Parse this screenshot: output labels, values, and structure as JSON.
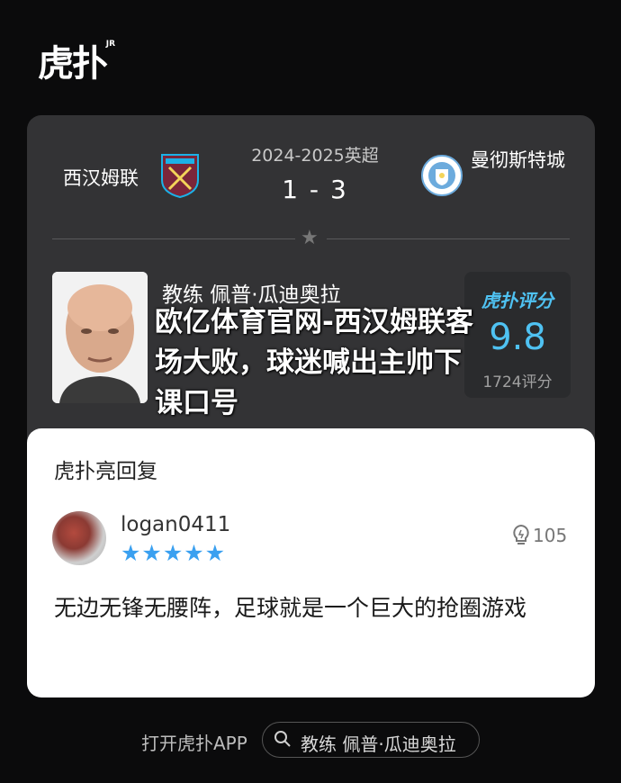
{
  "brand": {
    "logo_text": "虎扑",
    "logo_sup": "JR"
  },
  "match": {
    "home_team": "西汉姆联",
    "away_team": "曼彻斯特城",
    "season": "2024-2025英超",
    "score": "1 - 3"
  },
  "coach": {
    "label": "教练 佩普·瓜迪奥拉"
  },
  "rating": {
    "brand": "虎扑评分",
    "value": "9.8",
    "count": "1724评分"
  },
  "overlay_title": "欧亿体育官网-西汉姆联客场大败，球迷喊出主帅下课口号",
  "reply": {
    "header": "虎扑亮回复",
    "username": "logan0411",
    "stars": "★★★★★",
    "likes": "105",
    "comment": "无边无锋无腰阵，足球就是一个巨大的抢圈游戏"
  },
  "bottom": {
    "open_app": "打开虎扑APP",
    "search_text": "教练 佩普·瓜迪奥拉"
  },
  "colors": {
    "accent": "#4fc2f2",
    "card_bg": "#333335",
    "page_bg": "#0b0b0c",
    "star": "#3aa0f0"
  },
  "icons": [
    "star-icon",
    "west-ham-crest-icon",
    "man-city-crest-icon",
    "lightbulb-icon",
    "search-icon"
  ]
}
